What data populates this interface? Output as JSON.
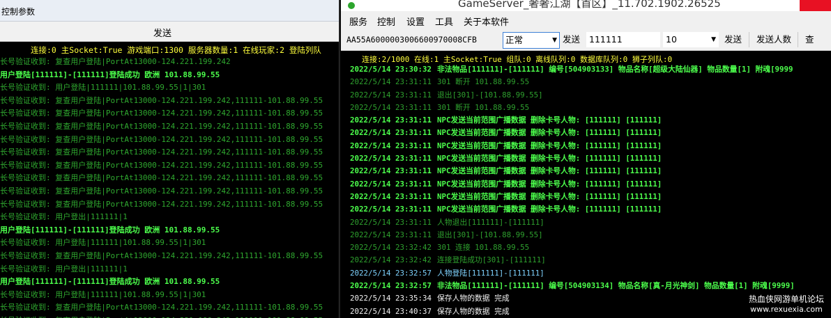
{
  "left": {
    "title": "控制参数",
    "send_button": "发送",
    "status": "连接:0 主Socket:True 游戏端口:1300 服务器数量:1 在线玩家:2 登陆列队",
    "log": [
      {
        "text": "长号验证收到: 复查用户登陆|PortAt13000-124.221.199.242",
        "style": "dim"
      },
      {
        "text": "用户登陆[111111]-[111111]登陆成功 欧洲 101.88.99.55",
        "style": "bright"
      },
      {
        "text": "长号验证收到: 用户登陆|111111|101.88.99.55|1|301",
        "style": "dim"
      },
      {
        "text": "长号验证收到: 复查用户登陆|PortAt13000-124.221.199.242,111111-101.88.99.55",
        "style": "dim"
      },
      {
        "text": "长号验证收到: 复查用户登陆|PortAt13000-124.221.199.242,111111-101.88.99.55",
        "style": "dim"
      },
      {
        "text": "长号验证收到: 复查用户登陆|PortAt13000-124.221.199.242,111111-101.88.99.55",
        "style": "dim"
      },
      {
        "text": "长号验证收到: 复查用户登陆|PortAt13000-124.221.199.242,111111-101.88.99.55",
        "style": "dim"
      },
      {
        "text": "长号验证收到: 复查用户登陆|PortAt13000-124.221.199.242,111111-101.88.99.55",
        "style": "dim"
      },
      {
        "text": "长号验证收到: 复查用户登陆|PortAt13000-124.221.199.242,111111-101.88.99.55",
        "style": "dim"
      },
      {
        "text": "长号验证收到: 复查用户登陆|PortAt13000-124.221.199.242,111111-101.88.99.55",
        "style": "dim"
      },
      {
        "text": "长号验证收到: 复查用户登陆|PortAt13000-124.221.199.242,111111-101.88.99.55",
        "style": "dim"
      },
      {
        "text": "长号验证收到: 复查用户登陆|PortAt13000-124.221.199.242,111111-101.88.99.55",
        "style": "dim"
      },
      {
        "text": "长号验证收到: 用户登出|111111|1",
        "style": "dim"
      },
      {
        "text": "用户登陆[111111]-[111111]登陆成功 欧洲 101.88.99.55",
        "style": "bright"
      },
      {
        "text": "长号验证收到: 用户登陆|111111|101.88.99.55|1|301",
        "style": "dim"
      },
      {
        "text": "长号验证收到: 复查用户登陆|PortAt13000-124.221.199.242,111111-101.88.99.55",
        "style": "dim"
      },
      {
        "text": "长号验证收到: 用户登出|111111|1",
        "style": "dim"
      },
      {
        "text": "用户登陆[111111]-[111111]登陆成功 欧洲 101.88.99.55",
        "style": "bright"
      },
      {
        "text": "长号验证收到: 用户登陆|111111|101.88.99.55|1|301",
        "style": "dim"
      },
      {
        "text": "长号验证收到: 复查用户登陆|PortAt13000-124.221.199.242,111111-101.88.99.55",
        "style": "dim"
      },
      {
        "text": "长号验证收到: 复查用户登陆|PortAt13000-124.221.199.242,111111-101.88.99.55",
        "style": "dim"
      }
    ]
  },
  "right": {
    "title": "GameServer_奢奢江湖【首区】_11.702.1902.26525",
    "menu": [
      "服务",
      "控制",
      "设置",
      "工具",
      "关于本软件"
    ],
    "toolbar": {
      "id_code": "AA55A6000003006600970008CFB",
      "mode": "正常",
      "send1": "发送",
      "message": "111111",
      "count": "10",
      "send2": "发送",
      "send_count": "发送人数",
      "query": "查"
    },
    "status": "连接:2/1000 在线:1 主Socket:True 组队:0 离线队列:0 数据库队列:0 狮子列队:0",
    "log": [
      {
        "time": "2022/5/14  23:30:32",
        "text": "非法物品[111111]-[111111] 编号[504903133] 物品名称[超级大陆仙器] 物品数量[1] 附魂[9999",
        "style": "c-green"
      },
      {
        "time": "2022/5/14  23:31:11",
        "text": "301 断开 101.88.99.55",
        "style": "c-dim"
      },
      {
        "time": "2022/5/14  23:31:11",
        "text": "退出[301]-[101.88.99.55]",
        "style": "c-dim"
      },
      {
        "time": "2022/5/14  23:31:11",
        "text": "301 断开 101.88.99.55",
        "style": "c-dim"
      },
      {
        "time": "2022/5/14  23:31:11",
        "text": "NPC发送当前范围广播数据 删除卡号人物: [111111] [111111]",
        "style": "c-green"
      },
      {
        "time": "2022/5/14  23:31:11",
        "text": "NPC发送当前范围广播数据 删除卡号人物: [111111] [111111]",
        "style": "c-green"
      },
      {
        "time": "2022/5/14  23:31:11",
        "text": "NPC发送当前范围广播数据 删除卡号人物: [111111] [111111]",
        "style": "c-green"
      },
      {
        "time": "2022/5/14  23:31:11",
        "text": "NPC发送当前范围广播数据 删除卡号人物: [111111] [111111]",
        "style": "c-green"
      },
      {
        "time": "2022/5/14  23:31:11",
        "text": "NPC发送当前范围广播数据 删除卡号人物: [111111] [111111]",
        "style": "c-green"
      },
      {
        "time": "2022/5/14  23:31:11",
        "text": "NPC发送当前范围广播数据 删除卡号人物: [111111] [111111]",
        "style": "c-green"
      },
      {
        "time": "2022/5/14  23:31:11",
        "text": "NPC发送当前范围广播数据 删除卡号人物: [111111] [111111]",
        "style": "c-green"
      },
      {
        "time": "2022/5/14  23:31:11",
        "text": "NPC发送当前范围广播数据 删除卡号人物: [111111] [111111]",
        "style": "c-green"
      },
      {
        "time": "2022/5/14  23:31:11",
        "text": "人物退出[111111]-[111111]",
        "style": "c-dim"
      },
      {
        "time": "2022/5/14  23:31:11",
        "text": "退出[301]-[101.88.99.55]",
        "style": "c-dim"
      },
      {
        "time": "2022/5/14  23:32:42",
        "text": "301 连接 101.88.99.55",
        "style": "c-dim"
      },
      {
        "time": "2022/5/14  23:32:42",
        "text": "连接登陆成功[301]-[111111]",
        "style": "c-dim"
      },
      {
        "time": "2022/5/14  23:32:57",
        "text": "人物登陆[111111]-[111111]",
        "style": "c-cyan"
      },
      {
        "time": "2022/5/14  23:32:57",
        "text": "非法物品[111111]-[111111] 编号[504903134] 物品名称[真-月光神剑] 物品数量[1] 附魂[9999]",
        "style": "c-green"
      },
      {
        "time": "2022/5/14  23:35:34",
        "text": "保存人物的数据 完成",
        "style": "c-white"
      },
      {
        "time": "2022/5/14  23:40:37",
        "text": "保存人物的数据 完成",
        "style": "c-white"
      }
    ]
  },
  "watermark": {
    "line1": "热血侠网游单机论坛",
    "line2": "www.rexuexia.com"
  }
}
